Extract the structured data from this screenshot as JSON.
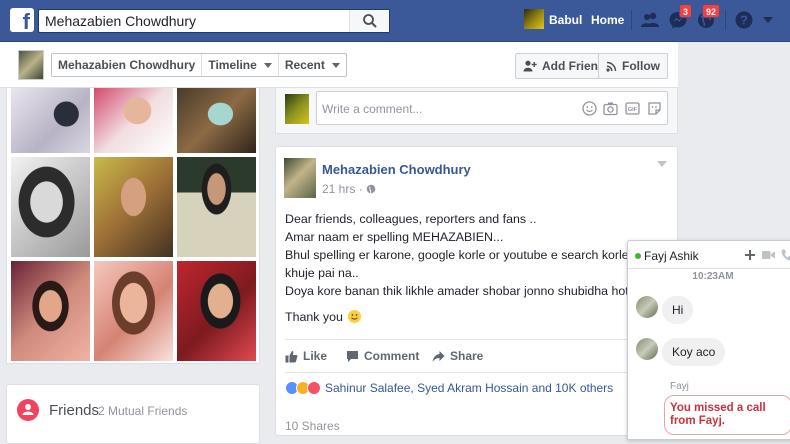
{
  "topbar": {
    "logo": "f",
    "search_value": "Mehazabien Chowdhury",
    "user_name": "Babul",
    "home_label": "Home",
    "friends_icon": "friends-icon",
    "messages_badge": "3",
    "notifications_badge": "92",
    "colors": {
      "bar": "#3b5998",
      "badge": "#fa3e3e"
    }
  },
  "profile_header": {
    "name_tab": "Mehazabien Chowdhury",
    "timeline_tab": "Timeline",
    "recent_tab": "Recent",
    "add_friend_label": "Add Friend",
    "follow_label": "Follow"
  },
  "friends_card": {
    "title": "Friends",
    "separator": "·",
    "subtitle": "2 Mutual Friends"
  },
  "comment": {
    "placeholder": "Write a comment..."
  },
  "post": {
    "author": "Mehazabien Chowdhury",
    "time": "21 hrs",
    "time_sep": "·",
    "lines": [
      "Dear friends, colleagues, reporters and fans ..",
      "Amar naam er spelling MEHAZABIEN...",
      "Bhul spelling er karone, google korle or youtube e search korle ami amake",
      "khuje pai na..",
      "Doya kore banan thik likhle amader shobar jonno shubidha hoto.",
      "Thank you"
    ],
    "actions": {
      "like": "Like",
      "comment": "Comment",
      "share": "Share"
    },
    "reactions_text": "Sahinur Salafee, Syed Akram Hossain and 10K others",
    "shares_text": "10 Shares"
  },
  "chat": {
    "name": "Fayj Ashik",
    "time_divider": "10:23AM",
    "messages": [
      "Hi",
      "Koy aco"
    ],
    "sender_label": "Fayj",
    "missed_call": "You missed a call from Fayj."
  }
}
